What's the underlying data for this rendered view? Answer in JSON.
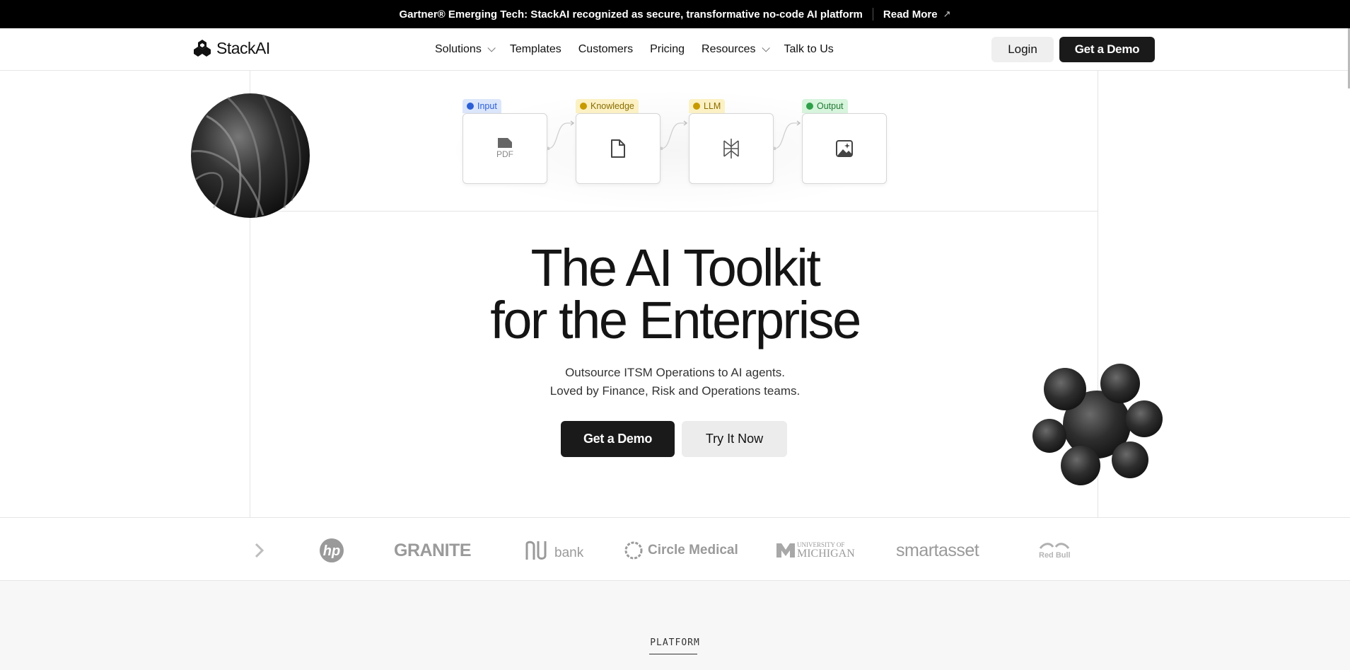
{
  "announcement": {
    "text": "Gartner® Emerging Tech: StackAI recognized as secure, transformative no-code AI platform",
    "link_label": "Read More",
    "arrow_icon": "arrow-up-right-icon"
  },
  "nav": {
    "brand": "StackAI",
    "links": [
      {
        "label": "Solutions",
        "dropdown": true
      },
      {
        "label": "Templates",
        "dropdown": false
      },
      {
        "label": "Customers",
        "dropdown": false
      },
      {
        "label": "Pricing",
        "dropdown": false
      },
      {
        "label": "Resources",
        "dropdown": true
      },
      {
        "label": "Talk to Us",
        "dropdown": false
      }
    ],
    "login_label": "Login",
    "demo_label": "Get a Demo"
  },
  "pipeline": {
    "nodes": [
      {
        "tag": "Input",
        "icon": "pdf-file-icon",
        "tag_bg": "#dbe6fb",
        "tag_color": "#2c5fd6",
        "dot_color": "#2c5fd6"
      },
      {
        "tag": "Knowledge",
        "icon": "document-icon",
        "tag_bg": "#fbf1c4",
        "tag_color": "#8a6d00",
        "dot_color": "#c79a00"
      },
      {
        "tag": "LLM",
        "icon": "llm-model-icon",
        "tag_bg": "#fbf1c4",
        "tag_color": "#8a6d00",
        "dot_color": "#c79a00"
      },
      {
        "tag": "Output",
        "icon": "image-icon",
        "tag_bg": "#d7f4dc",
        "tag_color": "#1f7a35",
        "dot_color": "#2ea04a"
      }
    ],
    "pdf_label": "PDF"
  },
  "hero": {
    "title_line1": "The AI Toolkit",
    "title_line2": "for the Enterprise",
    "subtitle_line1": "Outsource ITSM Operations to AI agents.",
    "subtitle_line2": "Loved by Finance, Risk and Operations teams.",
    "primary_cta": "Get a Demo",
    "secondary_cta": "Try It Now"
  },
  "logos": {
    "items": [
      {
        "name": "hp",
        "text": "hp"
      },
      {
        "name": "granite",
        "text": "GRANITE"
      },
      {
        "name": "nubank",
        "text": "bank"
      },
      {
        "name": "circle-medical",
        "text": "Circle Medical"
      },
      {
        "name": "university-of-michigan",
        "text_top": "UNIVERSITY OF",
        "text_bottom": "MICHIGAN"
      },
      {
        "name": "smartasset",
        "text": "smartasset"
      },
      {
        "name": "redbull",
        "text": "Red Bull"
      }
    ]
  },
  "platform": {
    "label": "PLATFORM"
  },
  "colors": {
    "announcement_bg": "#000000",
    "primary_button": "#1a1a1a",
    "secondary_button": "#ececec"
  }
}
